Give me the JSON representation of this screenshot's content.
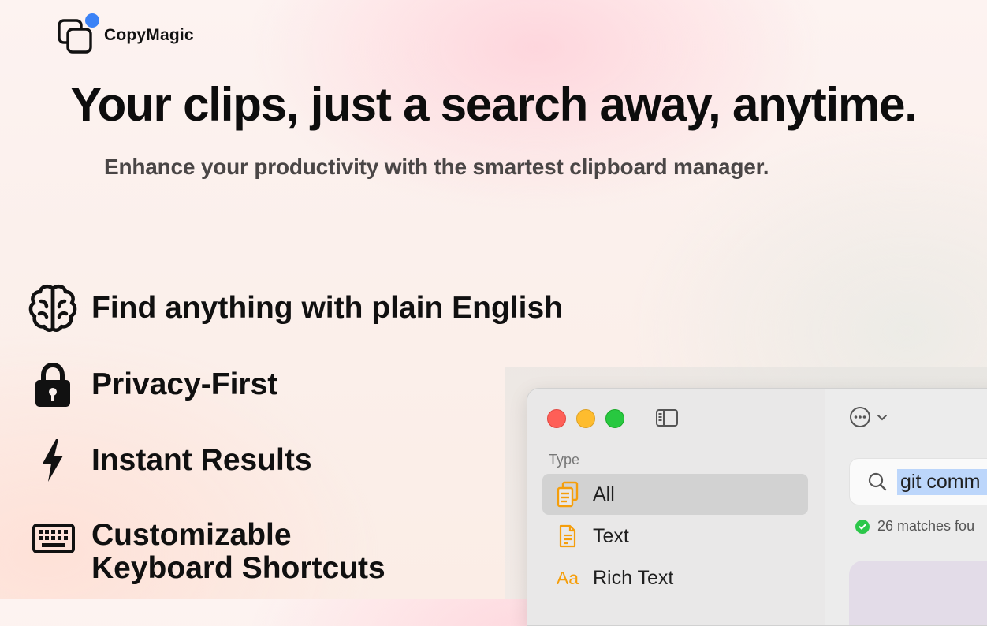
{
  "brand": {
    "name": "CopyMagic",
    "accent_color": "#3b82f6"
  },
  "hero": {
    "headline": "Your clips, just a search away, anytime.",
    "subheadline": "Enhance your productivity with the smartest clipboard manager."
  },
  "features": [
    {
      "icon": "brain-icon",
      "label": "Find anything with plain English"
    },
    {
      "icon": "lock-icon",
      "label": "Privacy-First"
    },
    {
      "icon": "lightning-icon",
      "label": "Instant Results"
    },
    {
      "icon": "keyboard-icon",
      "label_line1": "Customizable",
      "label_line2": "Keyboard Shortcuts"
    }
  ],
  "app_window": {
    "sidebar": {
      "section_label": "Type",
      "items": [
        {
          "label": "All",
          "icon": "copy-icon",
          "active": true
        },
        {
          "label": "Text",
          "icon": "document-icon",
          "active": false
        },
        {
          "label": "Rich Text",
          "icon": "rich-text-icon",
          "icon_text": "Aa",
          "active": false
        }
      ]
    },
    "search": {
      "value": "git comm",
      "status": "26 matches fou"
    },
    "colors": {
      "close": "#fe5f57",
      "minimize": "#febc2e",
      "zoom": "#28c840",
      "icon_orange": "#f59e0b",
      "match_green": "#2cc74a"
    }
  }
}
